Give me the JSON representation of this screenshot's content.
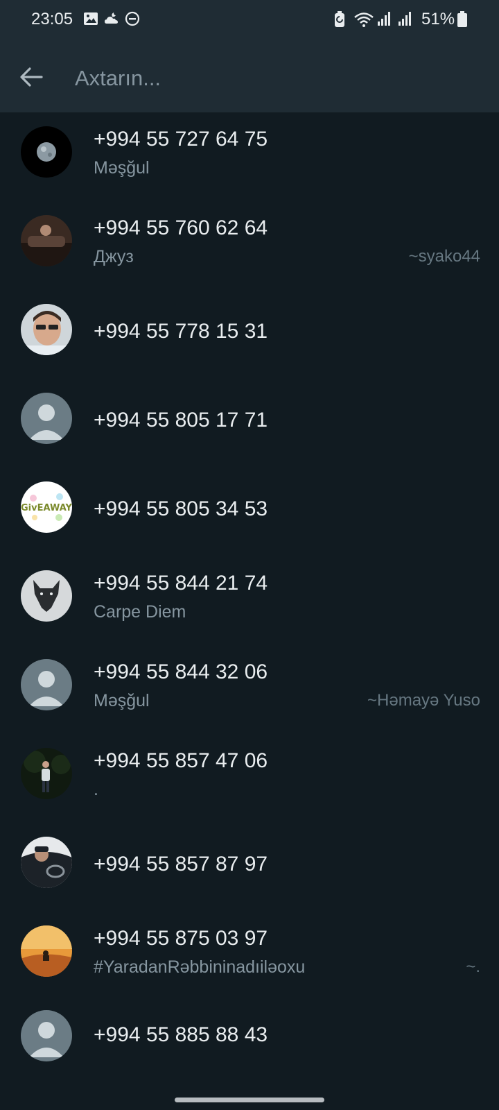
{
  "status_bar": {
    "time": "23:05",
    "battery_pct": "51%",
    "icons": [
      "gallery-icon",
      "cloud-night-icon",
      "do-not-disturb-icon",
      "battery-saver-icon",
      "wifi-icon",
      "signal-icon",
      "signal-icon",
      "battery-icon"
    ]
  },
  "search": {
    "placeholder": "Axtarın...",
    "value": ""
  },
  "contacts": [
    {
      "name": "+994 55 727 64 75",
      "about": "Məşğul",
      "alias": "",
      "avatar": "moon-photo"
    },
    {
      "name": "+994 55 760 62 64",
      "about": "Джуз",
      "alias": "~syako44",
      "avatar": "car-photo"
    },
    {
      "name": "+994 55 778 15 31",
      "about": "",
      "alias": "",
      "avatar": "man-sunglasses-photo"
    },
    {
      "name": "+994 55 805 17 71",
      "about": "",
      "alias": "",
      "avatar": "default-avatar-icon"
    },
    {
      "name": "+994 55 805 34 53",
      "about": "",
      "alias": "",
      "avatar": "giveaway-logo"
    },
    {
      "name": "+994 55 844 21 74",
      "about": "Carpe Diem",
      "alias": "",
      "avatar": "wolf-photo"
    },
    {
      "name": "+994 55 844 32 06",
      "about": "Məşğul",
      "alias": "~Həmayə Yuso",
      "avatar": "default-avatar-icon"
    },
    {
      "name": "+994 55 857 47 06",
      "about": ".",
      "alias": "",
      "avatar": "person-night-photo"
    },
    {
      "name": "+994 55 857 87 97",
      "about": "",
      "alias": "",
      "avatar": "car-driver-photo"
    },
    {
      "name": "+994 55 875 03 97",
      "about": "#YaradanRəbbininadıiləoxu",
      "alias": "~.",
      "avatar": "desert-photo"
    },
    {
      "name": "+994 55 885 88 43",
      "about": "",
      "alias": "",
      "avatar": "default-avatar-icon"
    }
  ],
  "colors": {
    "background": "#111b21",
    "appbar": "#1f2c34",
    "primary_text": "#e9edef",
    "secondary_text": "#8696a0",
    "alias_text": "#667781",
    "default_avatar": "#6b7c85"
  }
}
